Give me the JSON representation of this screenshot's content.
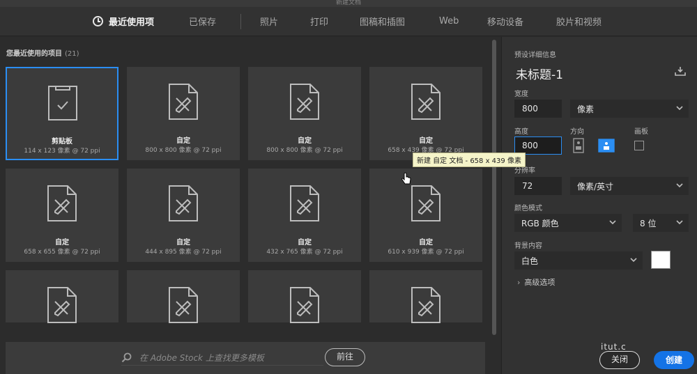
{
  "window": {
    "title": "新建文档"
  },
  "nav": {
    "tabs": [
      {
        "label": "最近使用项",
        "active": true
      },
      {
        "label": "已保存"
      },
      {
        "label": "照片"
      },
      {
        "label": "打印"
      },
      {
        "label": "图稿和插图"
      },
      {
        "label": "Web"
      },
      {
        "label": "移动设备"
      },
      {
        "label": "胶片和视频"
      }
    ]
  },
  "recent": {
    "heading": "您最近使用的项目",
    "count": "(21)",
    "items": [
      {
        "name": "剪贴板",
        "dims": "114 x 123 像素 @ 72 ppi",
        "icon": "clipboard-icon",
        "selected": true
      },
      {
        "name": "自定",
        "dims": "800 x 800 像素 @ 72 ppi",
        "icon": "custom-doc-icon"
      },
      {
        "name": "自定",
        "dims": "800 x 800 像素 @ 72 ppi",
        "icon": "custom-doc-icon"
      },
      {
        "name": "自定",
        "dims": "658 x 439 像素 @ 72 ppi",
        "icon": "custom-doc-icon"
      },
      {
        "name": "自定",
        "dims": "658 x 655 像素 @ 72 ppi",
        "icon": "custom-doc-icon"
      },
      {
        "name": "自定",
        "dims": "444 x 895 像素 @ 72 ppi",
        "icon": "custom-doc-icon"
      },
      {
        "name": "自定",
        "dims": "432 x 765 像素 @ 72 ppi",
        "icon": "custom-doc-icon"
      },
      {
        "name": "自定",
        "dims": "610 x 939 像素 @ 72 ppi",
        "icon": "custom-doc-icon"
      }
    ],
    "tooltip": "新建 自定 文档 - 658 x 439 像素"
  },
  "stock": {
    "placeholder": "在 Adobe Stock 上查找更多模板",
    "go_label": "前往"
  },
  "preset": {
    "section_label": "预设详细信息",
    "doc_title": "未标题-1",
    "width_label": "宽度",
    "width_value": "800",
    "width_unit": "像素",
    "height_label": "高度",
    "height_value": "800",
    "orientation_label": "方向",
    "artboard_label": "画板",
    "resolution_label": "分辨率",
    "resolution_value": "72",
    "resolution_unit": "像素/英寸",
    "color_mode_label": "颜色模式",
    "color_mode_value": "RGB 颜色",
    "bit_depth_value": "8 位",
    "background_label": "背景内容",
    "background_value": "白色",
    "background_color": "#ffffff",
    "advanced_label": "高级选项"
  },
  "footer": {
    "close_label": "关闭",
    "create_label": "创建",
    "watermark": "itut.c"
  },
  "colors": {
    "accent": "#1473e6",
    "selection": "#2b8ef3"
  }
}
